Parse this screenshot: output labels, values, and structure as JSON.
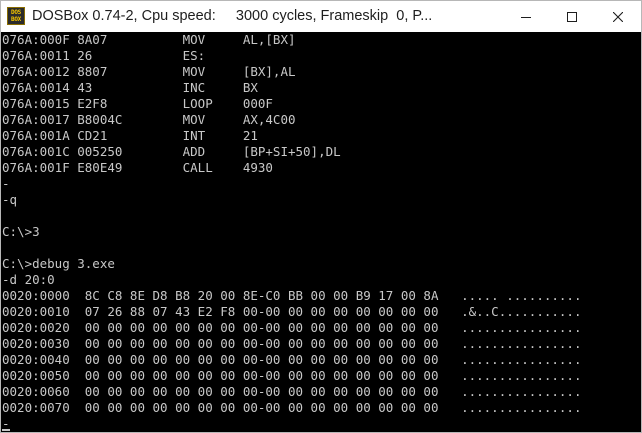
{
  "window": {
    "title": "DOSBox 0.74-2, Cpu speed:     3000 cycles, Frameskip  0, P...",
    "icon_lines": [
      "DOS",
      "BOX"
    ]
  },
  "controls": {
    "minimize": "minimize-icon",
    "maximize": "maximize-icon",
    "close": "close-icon"
  },
  "terminal": {
    "lines": [
      "076A:000F 8A07          MOV     AL,[BX]",
      "076A:0011 26            ES:",
      "076A:0012 8807          MOV     [BX],AL",
      "076A:0014 43            INC     BX",
      "076A:0015 E2F8          LOOP    000F",
      "076A:0017 B8004C        MOV     AX,4C00",
      "076A:001A CD21          INT     21",
      "076A:001C 005250        ADD     [BP+SI+50],DL",
      "076A:001F E80E49        CALL    4930",
      "-",
      "",
      "-q",
      "",
      "C:\\>3",
      "",
      "C:\\>debug 3.exe",
      "-d 20:0",
      "0020:0000  8C C8 8E D8 B8 20 00 8E-C0 BB 00 00 B9 17 00 8A   ..... ..........",
      "0020:0010  07 26 88 07 43 E2 F8 00-00 00 00 00 00 00 00 00   .&..C...........",
      "0020:0020  00 00 00 00 00 00 00 00-00 00 00 00 00 00 00 00   ................",
      "0020:0030  00 00 00 00 00 00 00 00-00 00 00 00 00 00 00 00   ................",
      "0020:0040  00 00 00 00 00 00 00 00-00 00 00 00 00 00 00 00   ................",
      "0020:0050  00 00 00 00 00 00 00 00-00 00 00 00 00 00 00 00   ................",
      "0020:0060  00 00 00 00 00 00 00 00-00 00 00 00 00 00 00 00   ................",
      "0020:0070  00 00 00 00 00 00 00 00-00 00 00 00 00 00 00 00   ................",
      "-"
    ],
    "text_color": "#c8c8c8",
    "background": "#000000"
  }
}
